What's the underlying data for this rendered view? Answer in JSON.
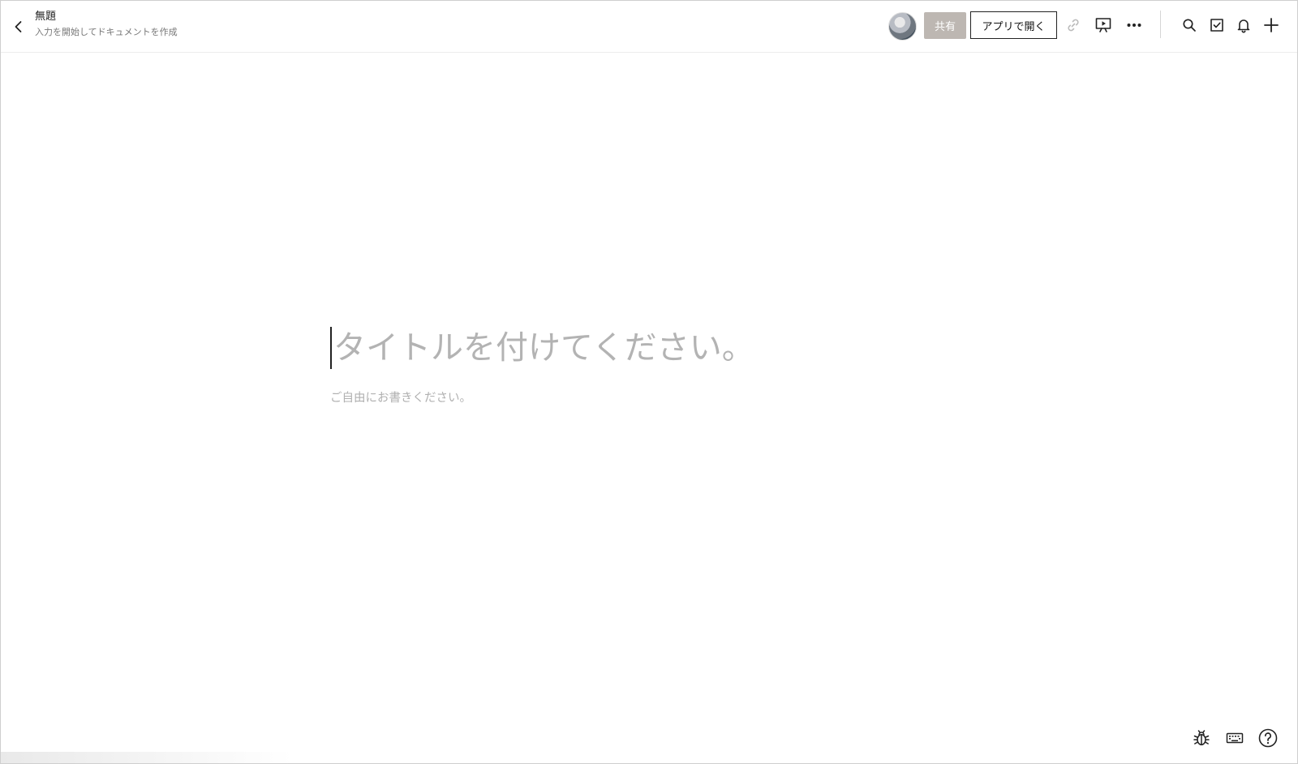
{
  "header": {
    "title": "無題",
    "subtitle": "入力を開始してドキュメントを作成",
    "share_label": "共有",
    "open_app_label": "アプリで開く"
  },
  "editor": {
    "title_placeholder": "タイトルを付けてください。",
    "body_placeholder": "ご自由にお書きください。"
  },
  "icons": {
    "back": "chevron-left-icon",
    "link": "link-icon",
    "present": "presentation-icon",
    "more": "more-horizontal-icon",
    "search": "search-icon",
    "tasks": "checkbox-icon",
    "notifications": "bell-icon",
    "add": "plus-icon",
    "bug": "bug-icon",
    "keyboard": "keyboard-icon",
    "help": "help-icon"
  },
  "colors": {
    "share_button_bg": "#bdb7b2",
    "placeholder": "#b3b3b3"
  }
}
